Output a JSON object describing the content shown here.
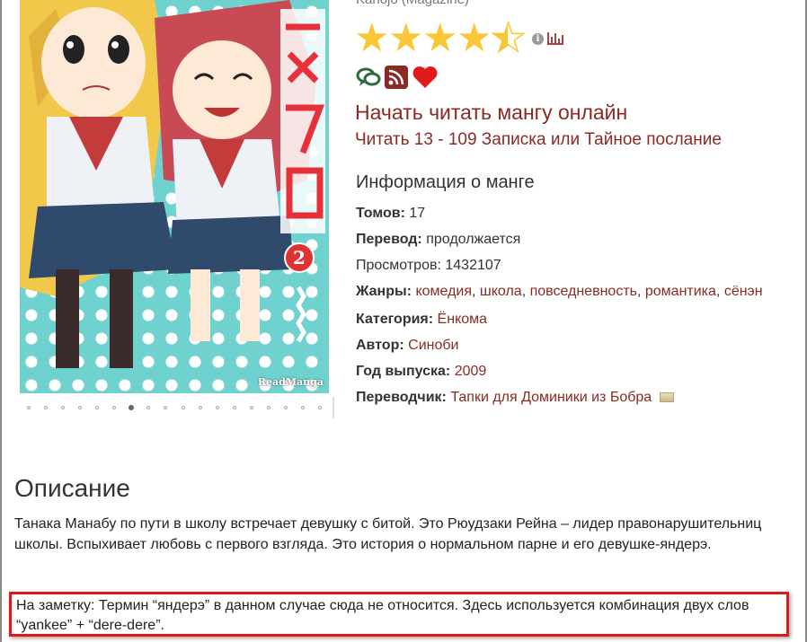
{
  "header": {
    "publisher_line": "Kanojo (Magazine)"
  },
  "cover": {
    "watermark": "ReadManga",
    "volume_badge": "2",
    "carousel_total": 18,
    "carousel_active_index": 6
  },
  "rating": {
    "stars_value": 4.5,
    "stars_max": 5,
    "info_icon": "info-icon",
    "stats_icon": "bar-chart-icon"
  },
  "actions": {
    "icons": [
      "comments-icon",
      "rss-icon",
      "heart-icon"
    ]
  },
  "reading": {
    "start_label": "Начать читать мангу онлайн",
    "chapter_label": "Читать 13 - 109 Записка или Тайное послание"
  },
  "info": {
    "heading": "Информация о манге",
    "volumes_label": "Томов:",
    "volumes_value": "17",
    "translation_label": "Перевод:",
    "translation_value": "продолжается",
    "views_label": "Просмотров:",
    "views_value": "1432107",
    "genres_label": "Жанры:",
    "genres": [
      {
        "name": "комедия",
        "sep": ", "
      },
      {
        "name": "школа",
        "sep": ", "
      },
      {
        "name": "повседневность",
        "sep": ", "
      },
      {
        "name": "романтика",
        "sep": ", "
      },
      {
        "name": "сёнэн",
        "sep": ""
      }
    ],
    "category_label": "Категория:",
    "category_value": "Ёнкома",
    "author_label": "Автор:",
    "author_value": "Синоби",
    "year_label": "Год выпуска:",
    "year_value": "2009",
    "translator_label": "Переводчик:",
    "translator_value": "Тапки для Доминики из Бобра"
  },
  "description": {
    "heading": "Описание",
    "text": "Танака Манабу по пути в школу встречает девушку с битой. Это Рюудзаки Рейна – лидер правонарушительниц школы. Вспыхивает любовь с первого взгляда. Это история о нормальном парне и его девушке-яндерэ.",
    "note": "На заметку: Термин “яндерэ” в данном случае сюда не относится. Здесь используется комбинация двух слов “yankee” + “dere-dere”."
  },
  "colors": {
    "link": "#8a2a22",
    "star": "#fbc636",
    "highlight_border": "#e0191b",
    "cover_background": "#6fd2cf"
  }
}
